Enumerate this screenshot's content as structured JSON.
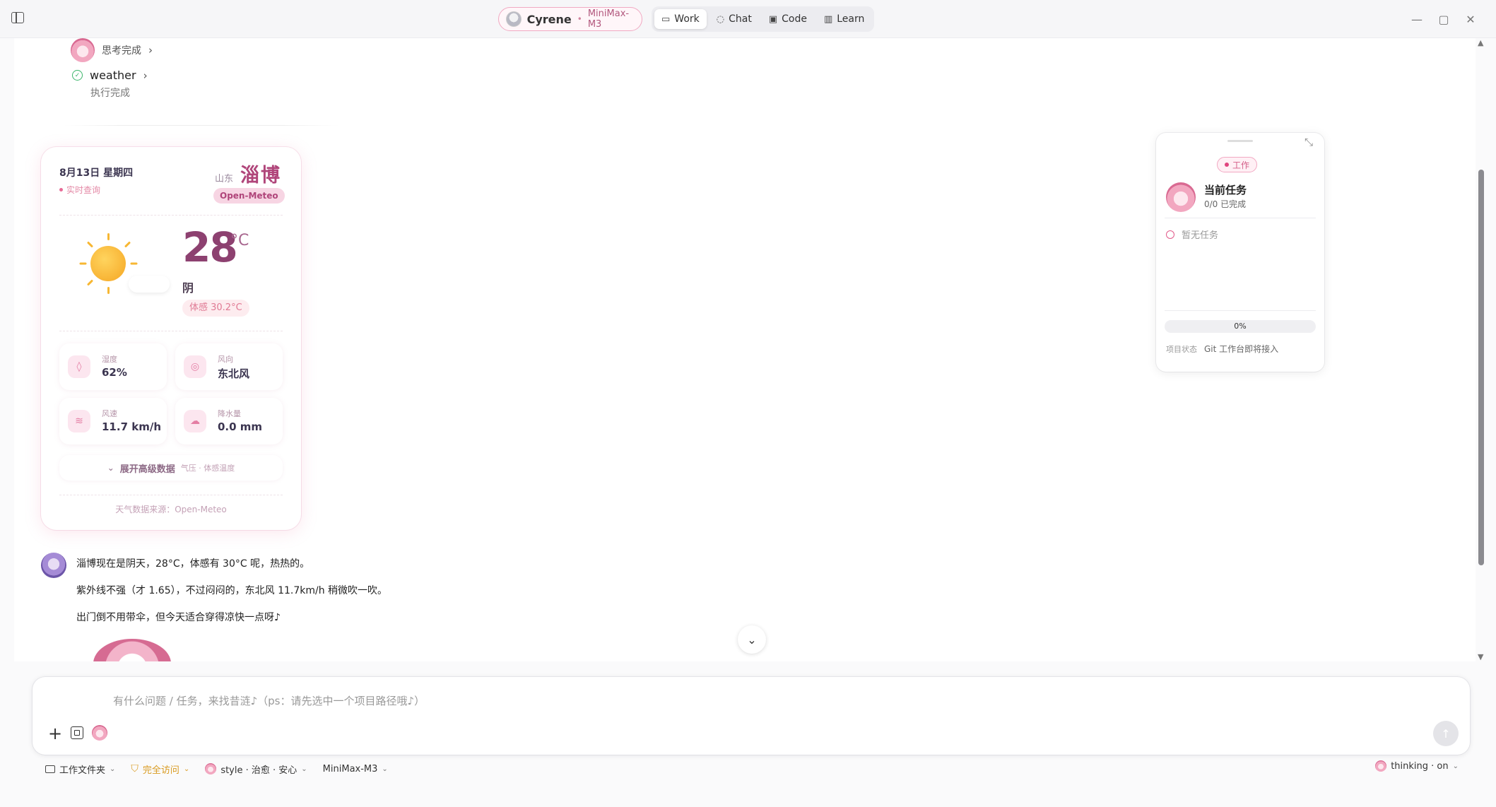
{
  "titlebar": {
    "persona_name": "Cyrene",
    "model_name": "MiniMax-M3",
    "tabs": [
      {
        "label": "Work",
        "icon": "monitor-icon",
        "active": true
      },
      {
        "label": "Chat",
        "icon": "chat-bubble-icon",
        "active": false
      },
      {
        "label": "Code",
        "icon": "code-icon",
        "active": false
      },
      {
        "label": "Learn",
        "icon": "book-icon",
        "active": false
      }
    ]
  },
  "conversation": {
    "thinking_label": "思考完成",
    "tool_name": "weather",
    "tool_status": "执行完成"
  },
  "weather": {
    "date": "8月13日 星期四",
    "live_label": "实时查询",
    "province": "山东",
    "city": "淄博",
    "source_badge": "Open-Meteo",
    "temperature": "28",
    "temp_unit": "°C",
    "condition": "阴",
    "feels_like": "体感 30.2°C",
    "stats": [
      {
        "label": "湿度",
        "value": "62%",
        "icon": "droplet-icon"
      },
      {
        "label": "风向",
        "value": "东北风",
        "icon": "compass-icon"
      },
      {
        "label": "风速",
        "value": "11.7 km/h",
        "icon": "wind-icon"
      },
      {
        "label": "降水量",
        "value": "0.0 mm",
        "icon": "rain-cloud-icon"
      }
    ],
    "expand_label": "展开高级数据",
    "expand_hint": "气压 · 体感温度",
    "footer": "天气数据来源：Open-Meteo"
  },
  "reply": {
    "lines": [
      "淄博现在是阴天，28°C，体感有 30°C 呢，热热的。",
      "紫外线不强（才 1.65），不过闷闷的，东北风 11.7km/h 稍微吹一吹。",
      "出门倒不用带伞，但今天适合穿得凉快一点呀♪"
    ]
  },
  "task_panel": {
    "badge": "工作",
    "title": "当前任务",
    "progress_text": "0/0 已完成",
    "empty_text": "暂无任务",
    "progress_label": "0%",
    "progress_fraction": 0,
    "status_label": "项目状态",
    "status_value": "Git 工作台即将接入"
  },
  "composer": {
    "placeholder": "有什么问题 / 任务，来找昔涟♪（ps：请先选中一个项目路径哦♪）",
    "value": ""
  },
  "bottombar": {
    "folder": "工作文件夹",
    "access": "完全访问",
    "style": "style · 治愈 · 安心",
    "model": "MiniMax-M3",
    "thinking": "thinking · on"
  }
}
